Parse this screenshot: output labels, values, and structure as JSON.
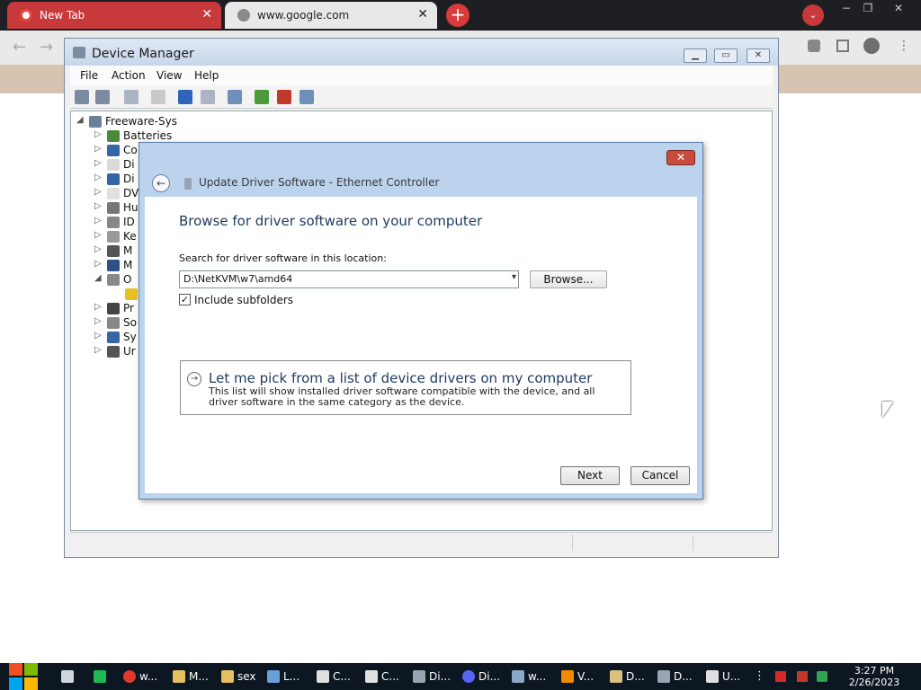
{
  "browser": {
    "tabs": [
      {
        "label": "New Tab",
        "close": "✕"
      },
      {
        "label": "www.google.com",
        "close": "✕"
      }
    ],
    "new_tab": "+",
    "profile_menu": "⌄",
    "window_controls": [
      "−",
      "❐",
      "✕"
    ]
  },
  "device_manager": {
    "title": "Device Manager",
    "menu": [
      "File",
      "Action",
      "View",
      "Help"
    ],
    "tree": [
      {
        "label": "Freeware-Sys",
        "expander": "◢",
        "color": "#6d7f9a"
      },
      {
        "label": "Batteries",
        "expander": "▷",
        "color": "#4a8a3a"
      },
      {
        "label": "Co",
        "expander": "▷",
        "color": "#3465a4"
      },
      {
        "label": "Di",
        "expander": "▷",
        "color": "#d9d9d9"
      },
      {
        "label": "Di",
        "expander": "▷",
        "color": "#3465a4"
      },
      {
        "label": "DV",
        "expander": "▷",
        "color": "#e0e0e0"
      },
      {
        "label": "Hu",
        "expander": "▷",
        "color": "#777777"
      },
      {
        "label": "ID",
        "expander": "▷",
        "color": "#888888"
      },
      {
        "label": "Ke",
        "expander": "▷",
        "color": "#999999"
      },
      {
        "label": "M",
        "expander": "▷",
        "color": "#555555"
      },
      {
        "label": "M",
        "expander": "▷",
        "color": "#2c4f8a"
      },
      {
        "label": "O",
        "expander": "◢",
        "color": "#888888"
      },
      {
        "label": "",
        "expander": "",
        "color": "#e8c020"
      },
      {
        "label": "Pr",
        "expander": "▷",
        "color": "#444444"
      },
      {
        "label": "So",
        "expander": "▷",
        "color": "#888888"
      },
      {
        "label": "Sy",
        "expander": "▷",
        "color": "#3465a4"
      },
      {
        "label": "Ur",
        "expander": "▷",
        "color": "#555555"
      }
    ]
  },
  "dialog": {
    "title": "Update Driver Software - Ethernet Controller",
    "close": "✕",
    "back": "←",
    "heading": "Browse for driver software on your computer",
    "search_label": "Search for driver software in this location:",
    "path_value": "D:\\NetKVM\\w7\\amd64",
    "browse_label": "Browse...",
    "include_subfolders_label": "Include subfolders",
    "include_subfolders_checked": "✓",
    "pick_title": "Let me pick from a list of device drivers on my computer",
    "pick_description": "This list will show installed driver software compatible with the device, and all driver software in the same category as the device.",
    "next_label": "Next",
    "cancel_label": "Cancel"
  },
  "taskbar": {
    "items": [
      {
        "label": "",
        "color": "#cfd8dc"
      },
      {
        "label": "",
        "color": "#1db954"
      },
      {
        "label": "w...",
        "color": "#e0392b"
      },
      {
        "label": "M...",
        "color": "#e5c060"
      },
      {
        "label": "sex",
        "color": "#e5c060"
      },
      {
        "label": "L...",
        "color": "#6aa0d8"
      },
      {
        "label": "C...",
        "color": "#e0e0e0"
      },
      {
        "label": "C...",
        "color": "#e0e0e0"
      },
      {
        "label": "Di...",
        "color": "#9aa4b1"
      },
      {
        "label": "Di...",
        "color": "#5865f2"
      },
      {
        "label": "w...",
        "color": "#8aa8c8"
      },
      {
        "label": "V...",
        "color": "#f08a00"
      },
      {
        "label": "D...",
        "color": "#d9c080"
      },
      {
        "label": "D...",
        "color": "#9aa4b1"
      },
      {
        "label": "U...",
        "color": "#e0e0e0"
      }
    ],
    "time": "3:27 PM",
    "date": "2/26/2023"
  }
}
